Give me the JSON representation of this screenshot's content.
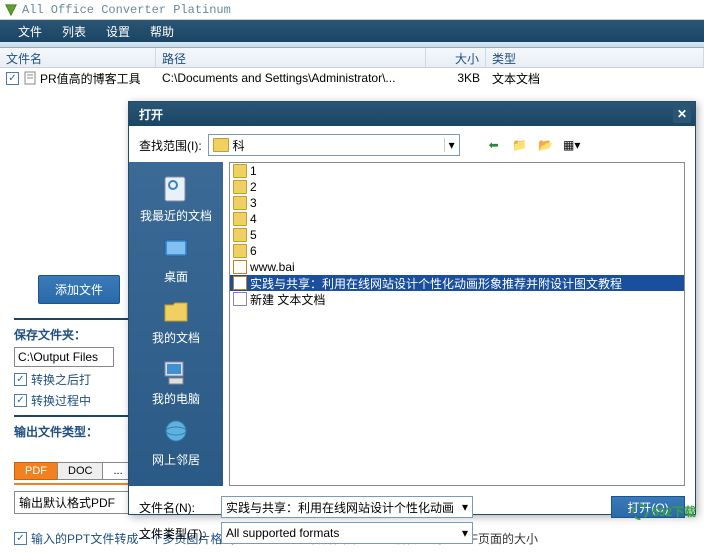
{
  "titlebar": {
    "title": "All Office Converter Platinum"
  },
  "menu": {
    "file": "文件",
    "list": "列表",
    "settings": "设置",
    "help": "帮助"
  },
  "table": {
    "headers": {
      "name": "文件名",
      "path": "路径",
      "size": "大小",
      "type": "类型"
    },
    "row": {
      "name": "PR值高的博客工具",
      "path": "C:\\Documents and Settings\\Administrator\\...",
      "size": "3KB",
      "type": "文本文档"
    }
  },
  "left": {
    "addfile": "添加文件",
    "savefolder_label": "保存文件夹：",
    "savefolder_value": "C:\\Output Files",
    "chk_open_after": "转换之后打",
    "chk_process": "转换过程中",
    "output_type_label": "输出文件类型：",
    "tabs": {
      "pdf": "PDF",
      "doc": "DOC",
      "more": "..."
    },
    "output_default": "输出默认格式PDF",
    "bottom_check": "输入的PPT文件转成一个多页图片格式PDF",
    "bottom_text2": "合并图片到PDF后自动调整PDF页面的大小"
  },
  "dialog": {
    "title": "打开",
    "lookin_label": "查找范围(I):",
    "lookin_value": "科",
    "sidebar": {
      "recent": "我最近的文档",
      "desktop": "桌面",
      "mydocs": "我的文档",
      "mycomputer": "我的电脑",
      "network": "网上邻居"
    },
    "files": {
      "f1": "1",
      "f2": "2",
      "f3": "3",
      "f4": "4",
      "f5": "5",
      "f6": "6",
      "www": "www.bai",
      "selected": "实践与共享：利用在线网站设计个性化动画形象推荐并附设计图文教程",
      "newtxt": "新建 文本文档"
    },
    "filename_label": "文件名(N):",
    "filename_value": "实践与共享：利用在线网站设计个性化动画",
    "filetype_label": "文件类型(T):",
    "filetype_value": "All supported formats",
    "open_btn": "打开(O)"
  },
  "watermark": "592下载"
}
